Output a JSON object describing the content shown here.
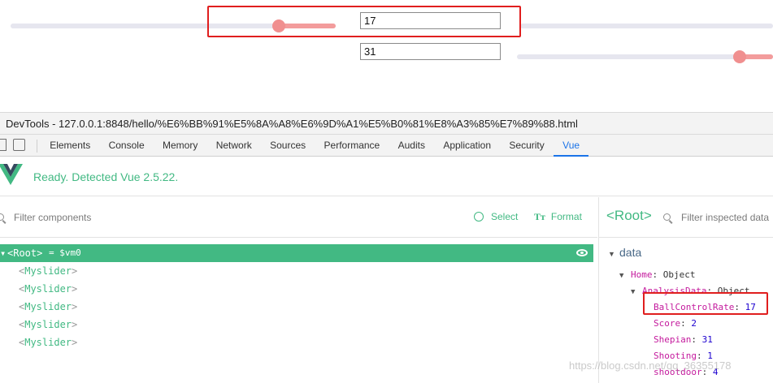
{
  "page": {
    "slider_1": {
      "value_label": "17",
      "fill_fraction": 0.36
    },
    "slider_2": {
      "value_label": "31",
      "fill_fraction": 0.93
    }
  },
  "devtools": {
    "title": "DevTools - 127.0.0.1:8848/hello/%E6%BB%91%E5%8A%A8%E6%9D%A1%E5%B0%81%E8%A3%85%E7%89%88.html",
    "tabs": [
      "Elements",
      "Console",
      "Memory",
      "Network",
      "Sources",
      "Performance",
      "Audits",
      "Application",
      "Security",
      "Vue"
    ],
    "active_tab": "Vue"
  },
  "vue": {
    "status": "Ready. Detected Vue 2.5.22.",
    "filter_placeholder": "Filter components",
    "select_label": "Select",
    "format_label": "Format",
    "root": {
      "arrow": "▾",
      "label": "<Root>",
      "vm": "= $vm0"
    },
    "components": [
      "Myslider",
      "Myslider",
      "Myslider",
      "Myslider",
      "Myslider"
    ],
    "inspector": {
      "title": "<Root>",
      "filter_placeholder": "Filter inspected data",
      "section": "data",
      "home_key": "Home",
      "home_value": "Object",
      "analysis_key": "AnalysisData",
      "analysis_value": "Object",
      "props": [
        {
          "key": "BallControlRate",
          "value": "17"
        },
        {
          "key": "Score",
          "value": "2"
        },
        {
          "key": "Shepian",
          "value": "31"
        },
        {
          "key": "Shooting",
          "value": "1"
        },
        {
          "key": "shootdoor",
          "value": "4"
        }
      ]
    }
  },
  "watermark": "https://blog.csdn.net/qq_36355178",
  "colors": {
    "vue_green": "#42b983",
    "slider_fill": "#f39c9c",
    "highlight_red": "#e01e1e",
    "tab_active": "#1a73e8"
  }
}
